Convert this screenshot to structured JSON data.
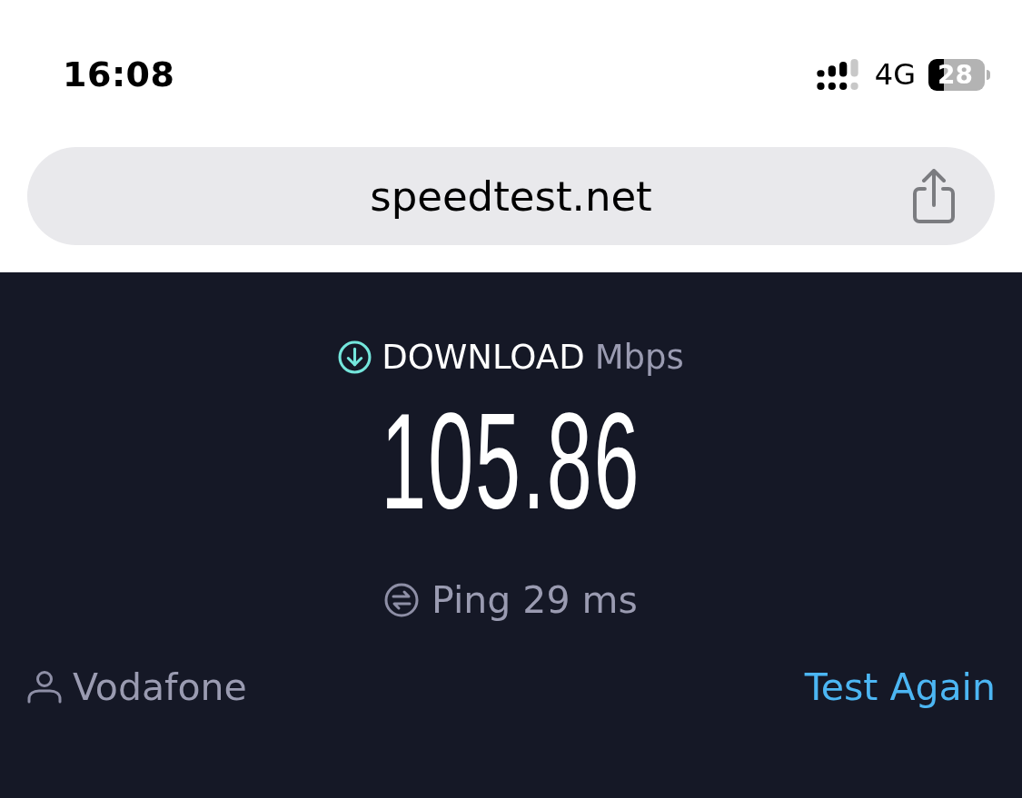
{
  "status_bar": {
    "time": "16:08",
    "network": "4G",
    "battery": "28"
  },
  "address_bar": {
    "url": "speedtest.net"
  },
  "result": {
    "label": "DOWNLOAD",
    "unit": "Mbps",
    "value": "105.86",
    "ping": "Ping 29 ms"
  },
  "footer": {
    "provider": "Vodafone",
    "action": "Test Again"
  }
}
